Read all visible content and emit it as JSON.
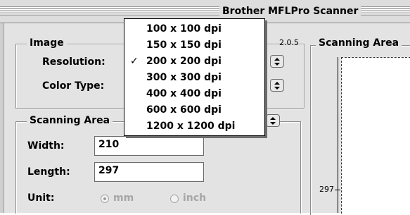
{
  "window": {
    "title": "Brother MFLPro Scanner"
  },
  "image_group": {
    "label": "Image",
    "resolution_label": "Resolution:",
    "color_type_label": "Color Type:"
  },
  "version": "2.0.5",
  "scanning_area_group": {
    "label": "Scanning Area",
    "width_label": "Width:",
    "width_value": "210",
    "length_label": "Length:",
    "length_value": "297",
    "unit_label": "Unit:",
    "unit_options": [
      "mm",
      "inch"
    ],
    "unit_selected": "mm"
  },
  "preview": {
    "label": "Scanning Area",
    "ruler_value": "297"
  },
  "resolution_menu": {
    "selected": "200 x 200 dpi",
    "items": [
      "100 x 100 dpi",
      "150 x 150 dpi",
      "200 x 200 dpi",
      "300 x 300 dpi",
      "400 x 400 dpi",
      "600 x 600 dpi",
      "1200 x 1200 dpi"
    ],
    "check_glyph": "✓"
  },
  "icons": {
    "stepper": "up-down-arrows-icon",
    "check": "checkmark-icon"
  }
}
